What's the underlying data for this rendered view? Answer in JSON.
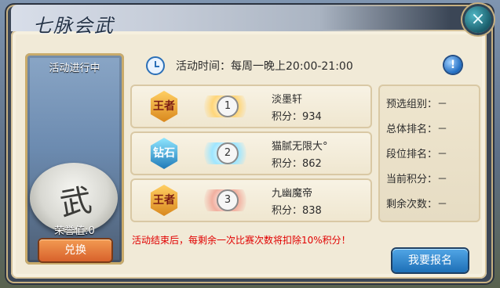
{
  "window": {
    "title": "七脉会武"
  },
  "left_panel": {
    "status": "活动进行中",
    "medal_glyph": "武",
    "honor": "荣誉值:0",
    "exchange_button": "兑换"
  },
  "top_row": {
    "time_text": "活动时间：每周一晚上20:00-21:00",
    "info_icon": "!"
  },
  "ranking": [
    {
      "badge": "王者",
      "badge_style": "king",
      "rank": "1",
      "name": "淡墨轩",
      "score": "积分：934"
    },
    {
      "badge": "钻石",
      "badge_style": "diamond",
      "rank": "2",
      "name": "猫腻无限大°",
      "score": "积分：862"
    },
    {
      "badge": "王者",
      "badge_style": "king",
      "rank": "3",
      "name": "九幽魔帝",
      "score": "积分：838"
    }
  ],
  "right_info": {
    "lines": [
      "预选组别：－",
      "总体排名：－",
      "段位排名：－",
      "当前积分：－",
      "剩余次数：－"
    ]
  },
  "notice": "活动结束后，每剩余一次比赛次数将扣除10%积分！",
  "signup_button": "我要报名",
  "icons": {
    "close": "close-icon",
    "clock": "clock-icon",
    "info": "info-icon",
    "medal": "medal-icon"
  }
}
